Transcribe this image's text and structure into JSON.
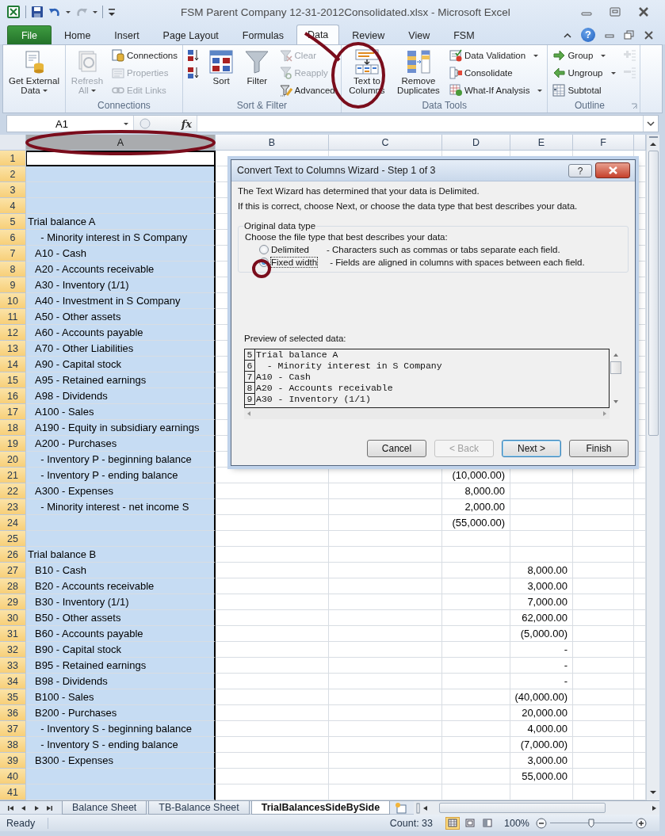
{
  "window": {
    "title": "FSM Parent Company 12-31-2012Consolidated.xlsx  -  Microsoft Excel"
  },
  "ribbon": {
    "tabs": [
      {
        "label": "File",
        "kind": "file",
        "selected": false
      },
      {
        "label": "Home",
        "kind": "tab",
        "selected": false
      },
      {
        "label": "Insert",
        "kind": "tab",
        "selected": false
      },
      {
        "label": "Page Layout",
        "kind": "tab",
        "selected": false
      },
      {
        "label": "Formulas",
        "kind": "tab",
        "selected": false
      },
      {
        "label": "Data",
        "kind": "tab",
        "selected": true
      },
      {
        "label": "Review",
        "kind": "tab",
        "selected": false
      },
      {
        "label": "View",
        "kind": "tab",
        "selected": false
      },
      {
        "label": "FSM",
        "kind": "tab",
        "selected": false
      }
    ],
    "help": "?",
    "groups": [
      {
        "buttons": [
          {
            "kind": "large",
            "label": "Get External Data",
            "dropdown": true,
            "disabled": false
          }
        ]
      },
      {
        "label": "Connections",
        "buttons": [
          {
            "kind": "large",
            "label": "Refresh All",
            "dropdown": true,
            "disabled": true
          },
          {
            "kind": "small",
            "label": "Connections",
            "dropdown": false,
            "disabled": false
          },
          {
            "kind": "small",
            "label": "Properties",
            "dropdown": false,
            "disabled": true
          },
          {
            "kind": "small",
            "label": "Edit Links",
            "dropdown": false,
            "disabled": true
          }
        ]
      },
      {
        "label": "Sort & Filter",
        "buttons": [
          {
            "kind": "icon",
            "dropdown": false,
            "disabled": false
          },
          {
            "kind": "icon",
            "dropdown": false,
            "disabled": false
          },
          {
            "kind": "large",
            "label": "Sort",
            "dropdown": false,
            "disabled": false
          },
          {
            "kind": "large",
            "label": "Filter",
            "dropdown": false,
            "disabled": false
          },
          {
            "kind": "small",
            "label": "Clear",
            "dropdown": false,
            "disabled": true
          },
          {
            "kind": "small",
            "label": "Reapply",
            "dropdown": false,
            "disabled": true
          },
          {
            "kind": "small",
            "label": "Advanced",
            "dropdown": false,
            "disabled": false
          }
        ]
      },
      {
        "label": "Data Tools",
        "buttons": [
          {
            "kind": "large",
            "label": "Text to Columns",
            "dropdown": false,
            "disabled": false
          },
          {
            "kind": "large",
            "label": "Remove Duplicates",
            "dropdown": false,
            "disabled": false
          },
          {
            "kind": "small",
            "label": "Data Validation",
            "dropdown": true,
            "disabled": false
          },
          {
            "kind": "small",
            "label": "Consolidate",
            "dropdown": false,
            "disabled": false
          },
          {
            "kind": "small",
            "label": "What-If Analysis",
            "dropdown": true,
            "disabled": false
          }
        ]
      },
      {
        "label": "Outline",
        "buttons": [
          {
            "kind": "small",
            "label": "Group",
            "dropdown": true,
            "disabled": false
          },
          {
            "kind": "small",
            "label": "Ungroup",
            "dropdown": true,
            "disabled": false
          },
          {
            "kind": "small",
            "label": "Subtotal",
            "dropdown": false,
            "disabled": false
          },
          {
            "kind": "icon",
            "dropdown": false,
            "disabled": true
          },
          {
            "kind": "icon",
            "dropdown": false,
            "disabled": true
          }
        ]
      }
    ]
  },
  "formula_bar": {
    "name_box": "A1",
    "function_label": "fx"
  },
  "sheet": {
    "columns": [
      {
        "label": "A",
        "selected": true
      },
      {
        "label": "B",
        "selected": false
      },
      {
        "label": "C",
        "selected": false
      },
      {
        "label": "D",
        "selected": false
      },
      {
        "label": "E",
        "selected": false
      },
      {
        "label": "F",
        "selected": false
      }
    ],
    "rows": [
      {
        "header": "1"
      },
      {
        "header": "2"
      },
      {
        "header": "3"
      },
      {
        "header": "4"
      },
      {
        "header": "5",
        "column_a": "Trial balance A",
        "indented": false
      },
      {
        "header": "6",
        "column_a": "  - Minority interest in S Company",
        "indented": true
      },
      {
        "header": "7",
        "column_a": "A10 - Cash",
        "indented": true
      },
      {
        "header": "8",
        "column_a": "A20 - Accounts receivable",
        "indented": true
      },
      {
        "header": "9",
        "column_a": "A30 - Inventory (1/1)",
        "indented": true
      },
      {
        "header": "10",
        "column_a": "A40 - Investment in S Company",
        "indented": true
      },
      {
        "header": "11",
        "column_a": "A50 - Other assets",
        "indented": true
      },
      {
        "header": "12",
        "column_a": "A60 - Accounts payable",
        "indented": true
      },
      {
        "header": "13",
        "column_a": "A70 - Other Liabilities",
        "indented": true
      },
      {
        "header": "14",
        "column_a": "A90 - Capital stock",
        "indented": true
      },
      {
        "header": "15",
        "column_a": "A95 - Retained earnings",
        "indented": true
      },
      {
        "header": "16",
        "column_a": "A98 - Dividends",
        "indented": true
      },
      {
        "header": "17",
        "column_a": "A100 - Sales",
        "indented": true
      },
      {
        "header": "18",
        "column_a": "A190 - Equity in subsidiary earnings",
        "indented": true
      },
      {
        "header": "19",
        "column_a": "A200 - Purchases",
        "indented": true
      },
      {
        "header": "20",
        "column_a": "  - Inventory P - beginning balance",
        "indented": true
      },
      {
        "header": "21",
        "column_a": "  - Inventory P - ending balance",
        "indented": true,
        "column_d": "(10,000.00)"
      },
      {
        "header": "22",
        "column_a": "A300 - Expenses",
        "indented": true,
        "column_d": "8,000.00"
      },
      {
        "header": "23",
        "column_a": "  - Minority interest - net income S",
        "indented": true,
        "column_d": "2,000.00"
      },
      {
        "header": "24",
        "column_d": "(55,000.00)"
      },
      {
        "header": "25"
      },
      {
        "header": "26",
        "column_a": "Trial balance B",
        "indented": false
      },
      {
        "header": "27",
        "column_a": "B10 - Cash",
        "indented": true,
        "column_e": "8,000.00"
      },
      {
        "header": "28",
        "column_a": "B20 - Accounts receivable",
        "indented": true,
        "column_e": "3,000.00"
      },
      {
        "header": "29",
        "column_a": "B30 - Inventory (1/1)",
        "indented": true,
        "column_e": "7,000.00"
      },
      {
        "header": "30",
        "column_a": "B50 - Other assets",
        "indented": true,
        "column_e": "62,000.00"
      },
      {
        "header": "31",
        "column_a": "B60 - Accounts payable",
        "indented": true,
        "column_e": "(5,000.00)"
      },
      {
        "header": "32",
        "column_a": "B90 - Capital stock",
        "indented": true,
        "column_e": "-"
      },
      {
        "header": "33",
        "column_a": "B95 - Retained earnings",
        "indented": true,
        "column_e": "-"
      },
      {
        "header": "34",
        "column_a": "B98 - Dividends",
        "indented": true,
        "column_e": "-"
      },
      {
        "header": "35",
        "column_a": "B100 - Sales",
        "indented": true,
        "column_e": "(40,000.00)"
      },
      {
        "header": "36",
        "column_a": "B200 - Purchases",
        "indented": true,
        "column_e": "20,000.00"
      },
      {
        "header": "37",
        "column_a": "  - Inventory S - beginning balance",
        "indented": true,
        "column_e": "4,000.00"
      },
      {
        "header": "38",
        "column_a": "  - Inventory S - ending balance",
        "indented": true,
        "column_e": "(7,000.00)"
      },
      {
        "header": "39",
        "column_a": "B300 - Expenses",
        "indented": true,
        "column_e": "3,000.00"
      },
      {
        "header": "40",
        "column_e": "55,000.00"
      },
      {
        "header": "41"
      }
    ]
  },
  "dialog": {
    "title": "Convert Text to Columns Wizard - Step 1 of 3",
    "help_button": "?",
    "messages": [
      "The Text Wizard has determined that your data is Delimited.",
      "If this is correct, choose Next, or choose the data type that best describes your data."
    ],
    "group_label": "Original data type",
    "prompt": "Choose the file type that best describes your data:",
    "options": [
      {
        "label": "Delimited",
        "description": "- Characters such as commas or tabs separate each field.",
        "selected": false
      },
      {
        "label": "Fixed width",
        "description": "- Fields are aligned in columns with spaces between each field.",
        "selected": true
      }
    ],
    "preview_label": "Preview of selected data:",
    "preview_rows": [
      {
        "number": "5",
        "text": "Trial balance A"
      },
      {
        "number": "6",
        "text": "  - Minority interest in S Company"
      },
      {
        "number": "7",
        "text": "A10 - Cash"
      },
      {
        "number": "8",
        "text": "A20 - Accounts receivable"
      },
      {
        "number": "9",
        "text": "A30 - Inventory (1/1)"
      }
    ],
    "buttons": [
      {
        "label": "Cancel",
        "disabled": false,
        "default": false
      },
      {
        "label": "< Back",
        "disabled": true,
        "default": false
      },
      {
        "label": "Next >",
        "disabled": false,
        "default": true
      },
      {
        "label": "Finish",
        "disabled": false,
        "default": false
      }
    ]
  },
  "sheet_tabs": [
    {
      "label": "Balance Sheet",
      "selected": false
    },
    {
      "label": "TB-Balance Sheet",
      "selected": false
    },
    {
      "label": "TrialBalancesSideBySide",
      "selected": true
    }
  ],
  "status_bar": {
    "status": "Ready",
    "count": "Count: 33",
    "views": [
      {
        "selected": true
      },
      {
        "selected": false
      },
      {
        "selected": false
      }
    ],
    "zoom": "100%",
    "zoom_slider": {
      "level": 0.5
    }
  }
}
